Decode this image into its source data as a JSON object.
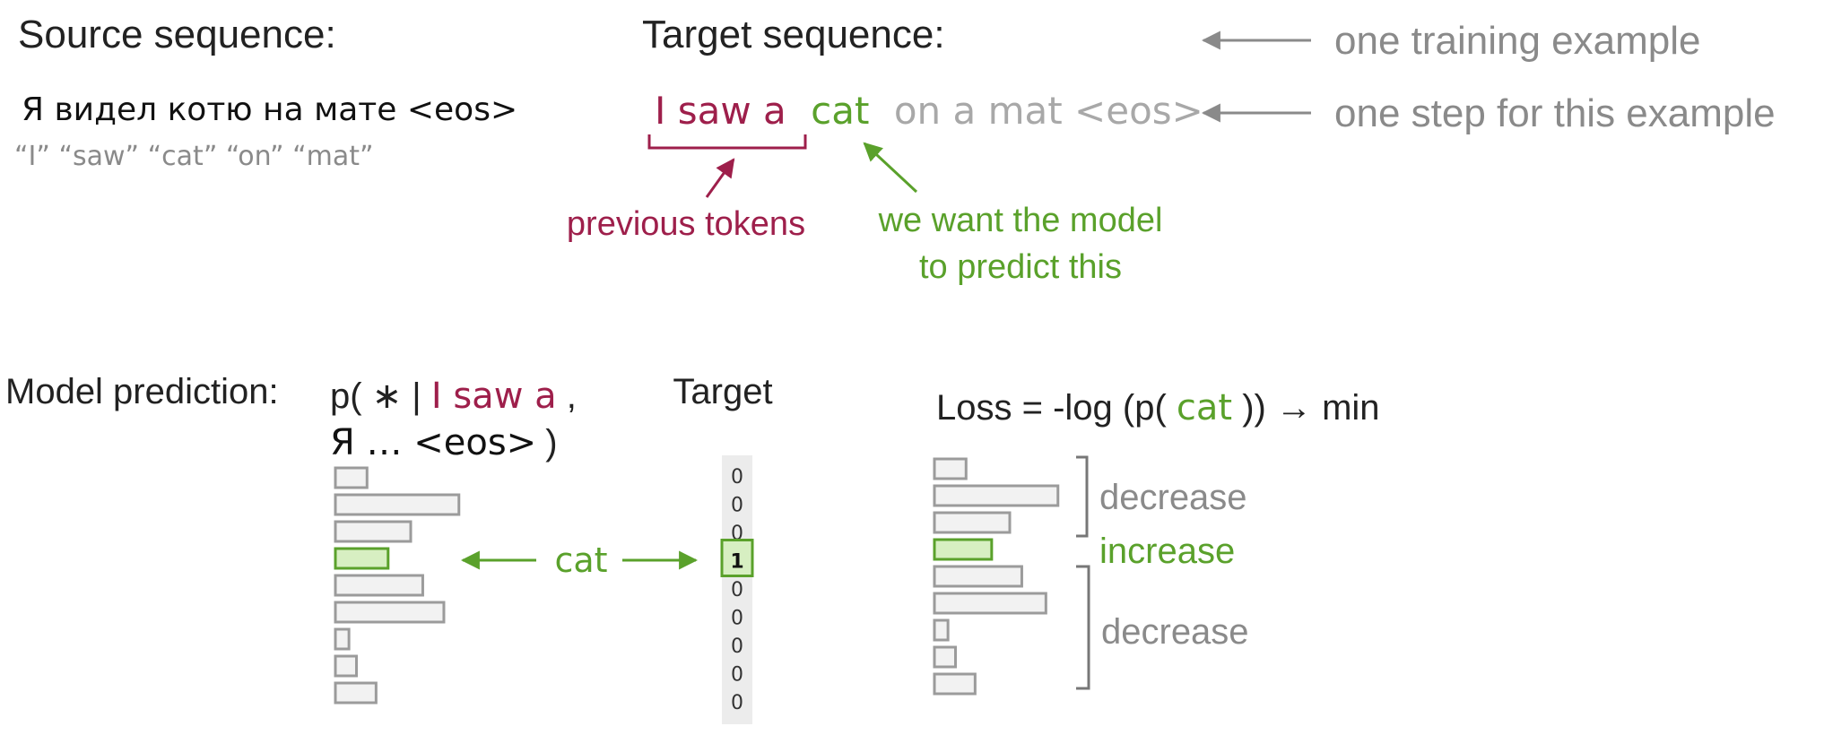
{
  "colors": {
    "crimson": "#9e1f4b",
    "green": "#5aa12b",
    "green_fill": "#d7efc2",
    "gray_text": "#8a8a8a",
    "light_gray_text": "#a8a8a8",
    "bar_stroke": "#9b9b9b",
    "bar_fill": "#f2f2f2",
    "bracket": "#777777",
    "target_bg": "#ececec",
    "black": "#111111"
  },
  "source": {
    "label": "Source sequence:",
    "sentence": "Я видел котю на мате <eos>",
    "gloss": "“I”  “saw” “cat”  “on”  “mat”"
  },
  "target": {
    "label": "Target sequence:",
    "prefix": "I saw a",
    "current": "cat",
    "rest": "on a mat <eos>",
    "previous_label": "previous tokens",
    "predict_label_line1": "we want the model",
    "predict_label_line2": "to predict this"
  },
  "annotations": {
    "one_training_example": "one training example",
    "one_step": "one step for this example"
  },
  "model": {
    "label": "Model prediction:",
    "prob_open": "p( ∗ |",
    "prob_context": "I saw a",
    "prob_comma": ",",
    "prob_line2_src": "Я … <eos>",
    "prob_line2_close": ")",
    "token": "cat",
    "bars": [
      0.21,
      0.82,
      0.5,
      0.35,
      0.58,
      0.72,
      0.09,
      0.14,
      0.27
    ],
    "highlight_index": 3
  },
  "target_vector": {
    "label": "Target",
    "values": [
      "0",
      "0",
      "0",
      "1",
      "0",
      "0",
      "0",
      "0",
      "0"
    ],
    "one_index": 3
  },
  "loss": {
    "prefix": "Loss = -log (p(",
    "token": "cat",
    "suffix": ")) → min",
    "bars": [
      0.21,
      0.82,
      0.5,
      0.38,
      0.58,
      0.74,
      0.09,
      0.14,
      0.27
    ],
    "highlight_index": 3,
    "decrease_top": "decrease",
    "increase": "increase",
    "decrease_bottom": "decrease"
  }
}
